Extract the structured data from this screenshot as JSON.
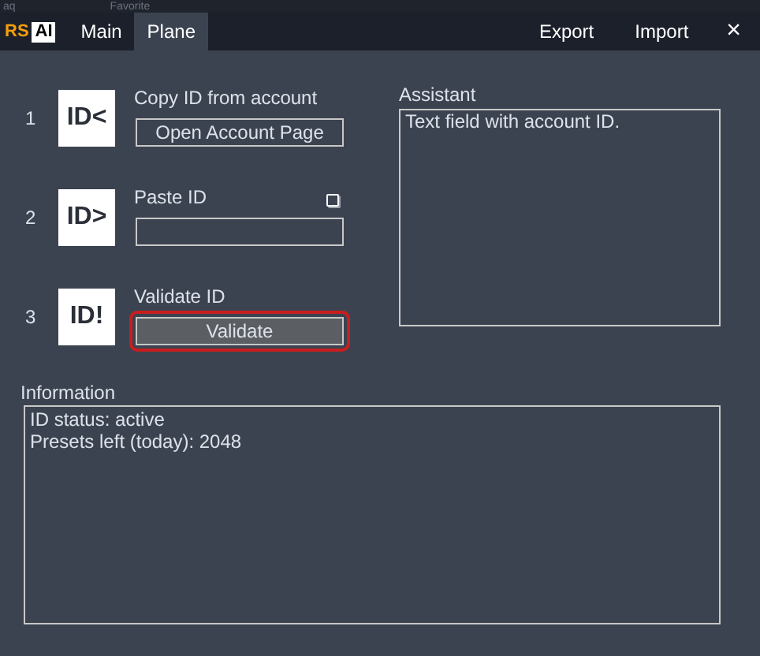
{
  "background_app": {
    "texts": [
      "aq",
      "Favorite"
    ]
  },
  "header": {
    "logo": {
      "left": "RS",
      "right": "AI"
    },
    "tabs": [
      {
        "label": "Main",
        "selected": false
      },
      {
        "label": "Plane",
        "selected": true
      }
    ],
    "actions": [
      "Export",
      "Import"
    ],
    "close": "×"
  },
  "steps": [
    {
      "number": "1",
      "badge": "ID<",
      "title": "Copy ID from account",
      "kind": "button",
      "control": "Open Account Page",
      "highlighted": false
    },
    {
      "number": "2",
      "badge": "ID>",
      "title": "Paste ID",
      "kind": "field",
      "highlighted": false
    },
    {
      "number": "3",
      "badge": "ID!",
      "title": "Validate ID",
      "kind": "button",
      "control": "Validate",
      "highlighted": true
    }
  ],
  "assistant": {
    "title": "Assistant",
    "text": "Text field with account ID."
  },
  "information": {
    "title": "Information",
    "lines": [
      "ID status: active",
      "Presets left (today): 2048"
    ]
  }
}
